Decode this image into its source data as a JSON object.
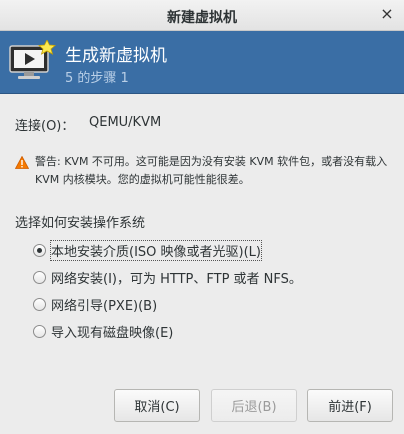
{
  "window": {
    "title": "新建虚拟机",
    "close_glyph": "×"
  },
  "header": {
    "title": "生成新虚拟机",
    "step": "5 的步骤 1",
    "icon": "vm-monitor-new-icon",
    "background": "#3a6ea5"
  },
  "connection": {
    "label": "连接(O)：",
    "value": "QEMU/KVM"
  },
  "warning": {
    "icon": "warning-triangle-icon",
    "text": "警告: KVM 不可用。这可能是因为没有安装 KVM 软件包，或者没有载入 KVM 内核模块。您的虚拟机可能性能很差。"
  },
  "install": {
    "label": "选择如何安装操作系统",
    "options": [
      {
        "label": "本地安装介质(ISO 映像或者光驱)(L)",
        "checked": true
      },
      {
        "label": "网络安装(I)，可为 HTTP、FTP 或者 NFS。",
        "checked": false
      },
      {
        "label": "网络引导(PXE)(B)",
        "checked": false
      },
      {
        "label": "导入现有磁盘映像(E)",
        "checked": false
      }
    ]
  },
  "buttons": {
    "cancel": "取消(C)",
    "back": "后退(B)",
    "forward": "前进(F)"
  }
}
